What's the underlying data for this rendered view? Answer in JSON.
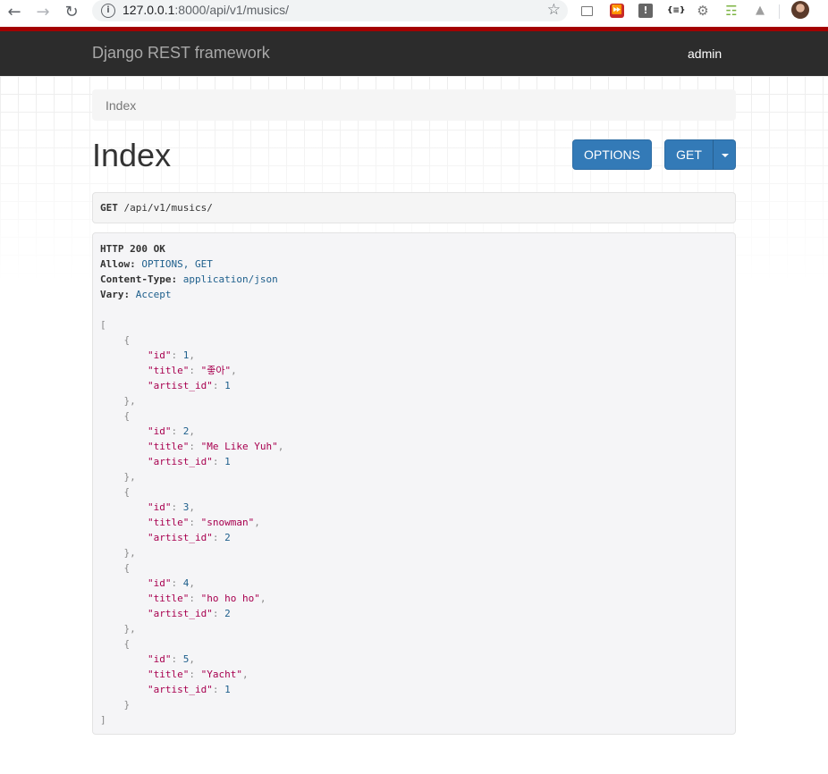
{
  "browser": {
    "url_host": "127.0.0.1",
    "url_rest": ":8000/api/v1/musics/"
  },
  "navbar": {
    "brand": "Django REST framework",
    "user": "admin"
  },
  "breadcrumb": {
    "items": [
      "Index"
    ]
  },
  "page": {
    "title": "Index"
  },
  "buttons": {
    "options": "OPTIONS",
    "get": "GET"
  },
  "request": {
    "method": "GET",
    "path": "/api/v1/musics/"
  },
  "response": {
    "status_line": "HTTP 200 OK",
    "headers": [
      {
        "name": "Allow",
        "value": "OPTIONS, GET"
      },
      {
        "name": "Content-Type",
        "value": "application/json"
      },
      {
        "name": "Vary",
        "value": "Accept"
      }
    ],
    "items": [
      {
        "id": "1",
        "title": "좋아",
        "artist_id": "1"
      },
      {
        "id": "2",
        "title": "Me Like Yuh",
        "artist_id": "1"
      },
      {
        "id": "3",
        "title": "snowman",
        "artist_id": "2"
      },
      {
        "id": "4",
        "title": "ho ho ho",
        "artist_id": "2"
      },
      {
        "id": "5",
        "title": "Yacht",
        "artist_id": "1"
      }
    ],
    "keys": {
      "id": "\"id\"",
      "title": "\"title\"",
      "artist_id": "\"artist_id\""
    }
  }
}
